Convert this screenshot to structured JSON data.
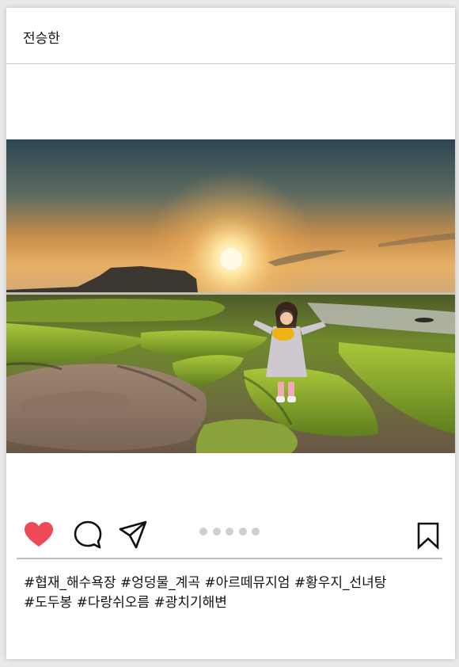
{
  "post": {
    "username": "전승한",
    "photo": {
      "subject": "girl-on-mossy-coastal-rocks-at-sunrise",
      "colors": {
        "sky_top": "#2f4d5c",
        "sky_glow": "#e8a24a",
        "sun": "#fff6d6",
        "moss": "#7ea32a",
        "rock": "#7a6656"
      }
    },
    "actions": {
      "like_icon": "heart-icon",
      "comment_icon": "comment-icon",
      "share_icon": "send-icon",
      "save_icon": "bookmark-icon",
      "like_color": "#ed4956",
      "carousel_count": 5
    },
    "caption": {
      "line1": [
        "#협재_해수욕장",
        "#엉덩물_계곡",
        "#아르떼뮤지엄",
        "#황우지_선녀탕"
      ],
      "line2": [
        "#도두봉",
        "#다랑쉬오름",
        "#광치기해변"
      ]
    }
  }
}
